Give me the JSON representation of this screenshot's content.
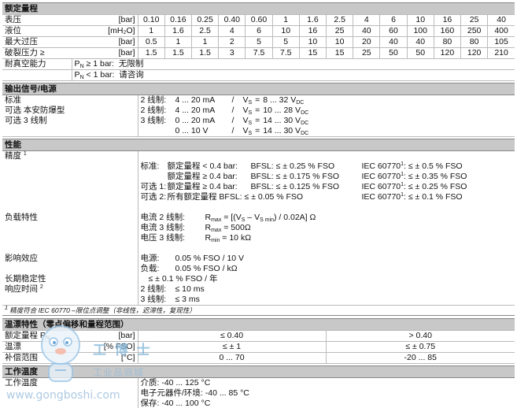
{
  "rated_range": {
    "title": "额定量程",
    "rows": [
      {
        "label": "表压",
        "unit": "[bar]",
        "values": [
          "0.10",
          "0.16",
          "0.25",
          "0.40",
          "0.60",
          "1",
          "1.6",
          "2.5",
          "4",
          "6",
          "10",
          "16",
          "25",
          "40"
        ]
      },
      {
        "label": "液位",
        "unit": "[mH₂O]",
        "values": [
          "1",
          "1.6",
          "2.5",
          "4",
          "6",
          "10",
          "16",
          "25",
          "40",
          "60",
          "100",
          "160",
          "250",
          "400"
        ]
      },
      {
        "label": "最大过压",
        "unit": "[bar]",
        "values": [
          "0.5",
          "1",
          "1",
          "2",
          "5",
          "5",
          "10",
          "10",
          "20",
          "40",
          "40",
          "80",
          "80",
          "105"
        ]
      },
      {
        "label": "破裂压力 ≥",
        "unit": "[bar]",
        "values": [
          "1.5",
          "1.5",
          "1.5",
          "3",
          "7.5",
          "7.5",
          "15",
          "15",
          "25",
          "50",
          "50",
          "120",
          "120",
          "210"
        ]
      }
    ],
    "vacuum_label": "耐真空能力",
    "vacuum_lines": [
      {
        "p": "P",
        "sub": "N",
        "cond": " ≥ 1 bar:",
        "val": "无限制"
      },
      {
        "p": "P",
        "sub": "N",
        "cond": " < 1 bar:",
        "val": "请咨询"
      }
    ]
  },
  "output": {
    "title": "输出信号/电源",
    "rows": [
      {
        "label": "标准",
        "lines": [
          {
            "a": "2 线制:",
            "b": "4 ... 20 mA",
            "c": "V",
            "cs": "S",
            "d": "8 ... 32 V",
            "ds": "DC"
          }
        ]
      },
      {
        "label": "可选  本安防爆型",
        "lines": [
          {
            "a": "2 线制:",
            "b": "4 ... 20 mA",
            "c": "V",
            "cs": "S",
            "d": "10 ... 28 V",
            "ds": "DC"
          }
        ]
      },
      {
        "label": "可选  3 线制",
        "lines": [
          {
            "a": "3 线制:",
            "b": "0 ... 20 mA",
            "c": "V",
            "cs": "S",
            "d": "14 ... 30 V",
            "ds": "DC"
          },
          {
            "a": "",
            "b": "0 ... 10 V",
            "c": "V",
            "cs": "S",
            "d": "14 ... 30 V",
            "ds": "DC"
          }
        ]
      }
    ]
  },
  "performance": {
    "title": "性能",
    "accuracy_label": "精度",
    "accuracy_sup": "1",
    "accuracy_rows": [
      {
        "pre": "标准:",
        "range": "额定量程  < 0.4 bar:",
        "val": "BFSL: ≤ ± 0.25 % FSO",
        "iec": "IEC 60770",
        "iecsup": "1",
        "iecval": ": ≤ ± 0.5 % FSO"
      },
      {
        "pre": "",
        "range": "额定量程  ≥ 0.4 bar:",
        "val": "BFSL: ≤ ± 0.175 % FSO",
        "iec": "IEC 60770",
        "iecsup": "1",
        "iecval": ": ≤ ± 0.35 % FSO"
      },
      {
        "pre": "可选 1:",
        "range": "额定量程 ≥ 0.4 bar:",
        "val": "BFSL: ≤ ± 0.125 % FSO",
        "iec": "IEC 60770",
        "iecsup": "1",
        "iecval": ": ≤ ± 0.25 % FSO"
      },
      {
        "pre": "可选 2:",
        "range": "所有额定量程  BFSL: ≤ ± 0.05 % FSO",
        "val": "",
        "iec": "IEC 60770",
        "iecsup": "1",
        "iecval": ": ≤ ± 0.1 % FSO"
      }
    ],
    "load_label": "负载特性",
    "load_rows": [
      {
        "a": "电流  2 线制:",
        "r": "R",
        "rs": "max",
        "v": " = [(V",
        "v2": "S",
        "v3": " – V",
        "v4": "S min",
        "v5": ") / 0.02A] Ω"
      },
      {
        "a": "电流  3 线制:",
        "r": "R",
        "rs": "max",
        "v": " = 500Ω",
        "v2": "",
        "v3": "",
        "v4": "",
        "v5": ""
      },
      {
        "a": "电压  3 线制:",
        "r": "R",
        "rs": "min",
        "v": " = 10 kΩ",
        "v2": "",
        "v3": "",
        "v4": "",
        "v5": ""
      }
    ],
    "influence_label": "影响效应",
    "influence_rows": [
      {
        "a": "电源:",
        "b": "0.05 % FSO / 10 V"
      },
      {
        "a": "负载:",
        "b": "0.05 % FSO / kΩ"
      }
    ],
    "stability_label": "长期稳定性",
    "stability_val": "≤ ± 0.1 % FSO / 年",
    "response_label": "响应时间",
    "response_sup": "2",
    "response_rows": [
      {
        "a": "2 线制:",
        "b": "≤ 10 ms"
      },
      {
        "a": "3 线制:",
        "b": "≤ 3 ms"
      }
    ],
    "footnote_sup": "1",
    "footnote": "精度符合 IEC 60770 –限位点调整（非线性，迟滞性，复现性）"
  },
  "temp_char": {
    "title": "温漂特性（零点偏移和量程范围）",
    "rows": [
      {
        "label": "额定量程 P",
        "labsub": "N",
        "unit": "[bar]",
        "a": "≤ 0.40",
        "b": "> 0.40"
      },
      {
        "label": "温漂",
        "labsub": "",
        "unit": "[% FSO]",
        "a": "≤ ± 1",
        "b": "≤ ± 0.75"
      },
      {
        "label": "补偿范围",
        "labsub": "",
        "unit": "[°C]",
        "a": "0 ... 70",
        "b": "-20 ... 85"
      }
    ]
  },
  "op_temp": {
    "title": "工作温度",
    "label": "工作温度",
    "lines": [
      "介质: -40 ... 125 °C",
      "电子元器件/环境: -40 ... 85 °C",
      "保存: -40 ... 100 °C"
    ]
  },
  "watermark": {
    "brand": "工 博 士",
    "tagline": "工业品商城",
    "url": "www.gongboshi.com"
  }
}
